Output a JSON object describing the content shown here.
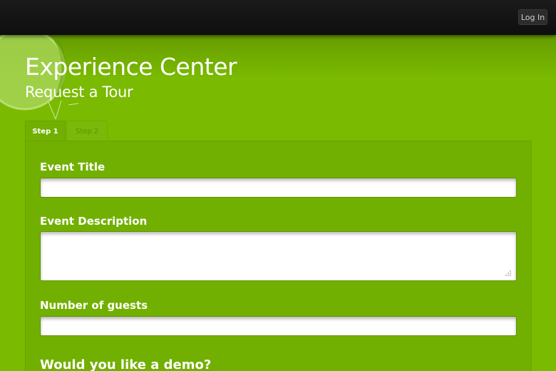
{
  "topbar": {
    "login_label": "Log In"
  },
  "header": {
    "title": "Experience Center",
    "subtitle": "Request a Tour"
  },
  "tabs": [
    {
      "label": "Step 1",
      "active": true
    },
    {
      "label": "Step 2",
      "active": false
    }
  ],
  "form": {
    "event_title": {
      "label": "Event Title",
      "value": "",
      "placeholder": ""
    },
    "event_description": {
      "label": "Event Description",
      "value": "",
      "placeholder": ""
    },
    "guests": {
      "label": "Number of guests",
      "value": "",
      "placeholder": ""
    },
    "demo_question": "Would you like a demo?"
  },
  "colors": {
    "background": "#7aba00",
    "panel": "#71b000",
    "topbar": "#141414",
    "text": "#ffffff"
  },
  "icons": {
    "decoration": "green-balloon-icon",
    "resize": "resize-grip-icon"
  }
}
